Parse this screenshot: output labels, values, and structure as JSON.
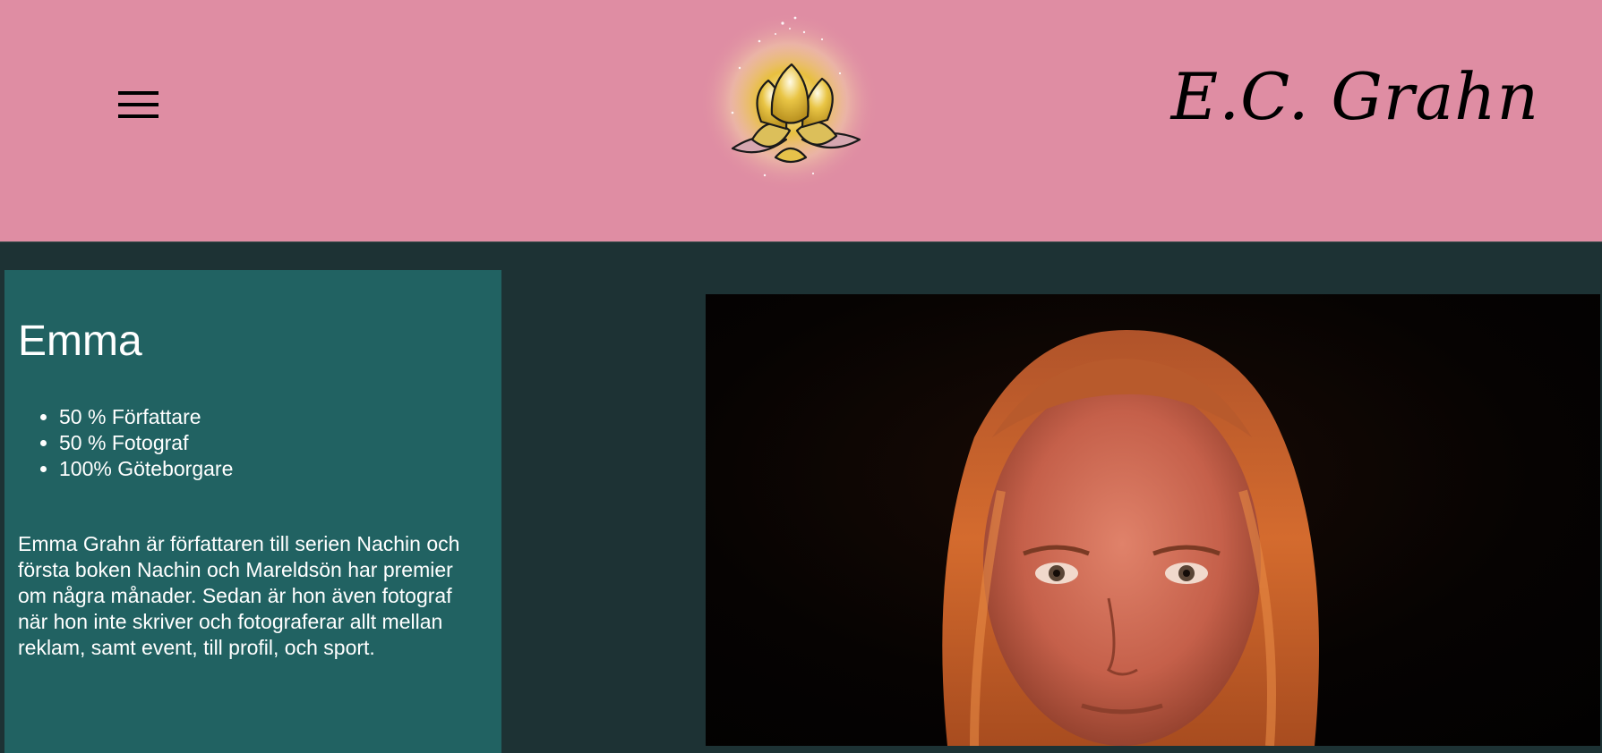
{
  "header": {
    "brand_name": "E.C. Grahn",
    "menu_icon": "hamburger-menu-icon",
    "logo_icon": "lotus-flower-icon",
    "background_color": "#df8da3"
  },
  "about": {
    "title": "Emma",
    "traits": [
      "50 % Författare",
      "50 % Fotograf",
      "100% Göteborgare"
    ],
    "bio": "Emma Grahn är författaren till serien Nachin och första boken Nachin och Mareldsön har premier om några månader. Sedan är hon även fotograf när hon inte skriver och fotograferar allt mellan reklam, samt event, till profil, och sport.",
    "panel_color": "#216262"
  },
  "photo": {
    "subject": "portrait-photo"
  },
  "colors": {
    "page_background": "#1d3234",
    "text_light": "#ffffff"
  }
}
